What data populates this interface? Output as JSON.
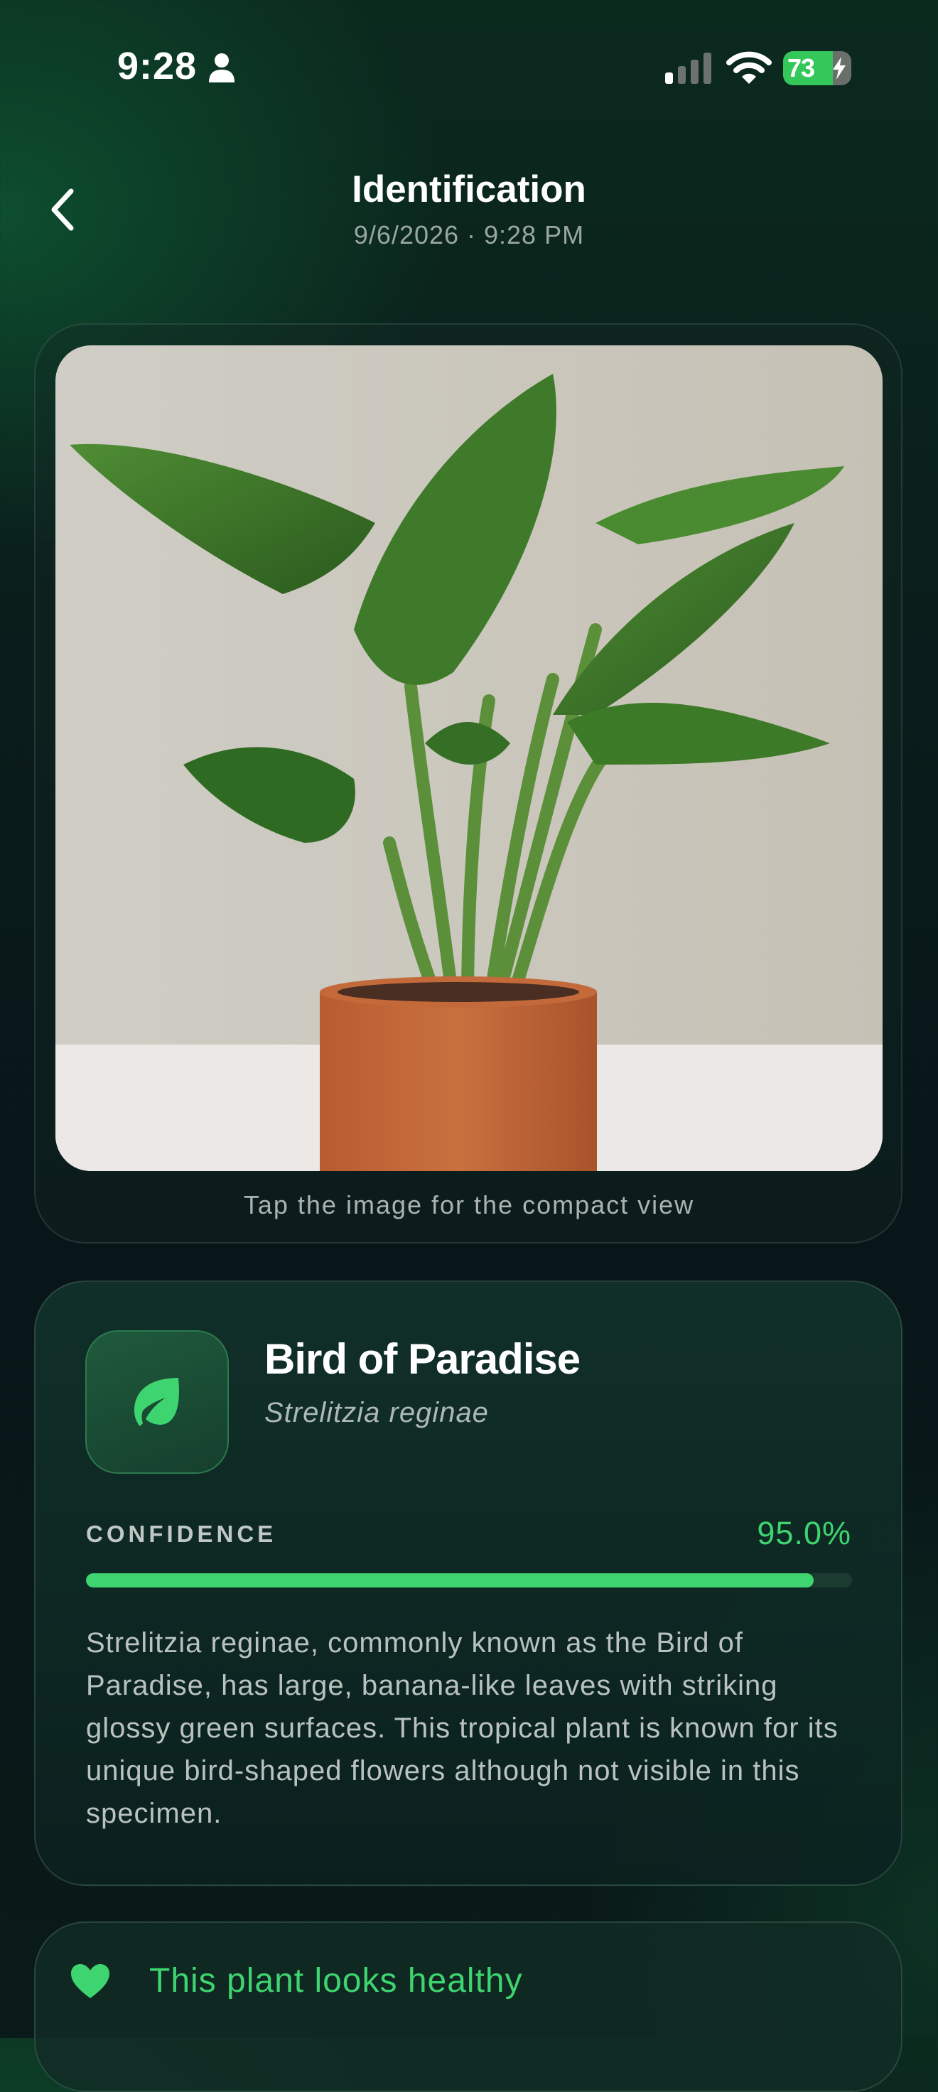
{
  "status_bar": {
    "time": "9:28",
    "battery": "73",
    "battery_level": 0.73
  },
  "header": {
    "title": "Identification",
    "subtitle": "9/6/2026 · 9:28 PM"
  },
  "image_card": {
    "hint": "Tap the image for the compact view"
  },
  "result": {
    "name": "Bird of Paradise",
    "scientific_name": "Strelitzia reginae",
    "confidence_label": "CONFIDENCE",
    "confidence_value": "95.0%",
    "confidence_fraction": 0.95,
    "description": "Strelitzia reginae, commonly known as the Bird of Paradise, has large, banana-like leaves with striking glossy green surfaces. This tropical plant is known for its unique bird-shaped flowers although not visible in this specimen."
  },
  "health": {
    "status_text": "This plant looks healthy"
  },
  "colors": {
    "accent": "#3ed46f",
    "background": "#0a1d1b",
    "battery": "#34c759"
  },
  "icons": [
    "person-icon",
    "signal-icon",
    "wifi-icon",
    "bolt-icon",
    "chevron-left-icon",
    "leaf-icon",
    "heart-icon"
  ]
}
